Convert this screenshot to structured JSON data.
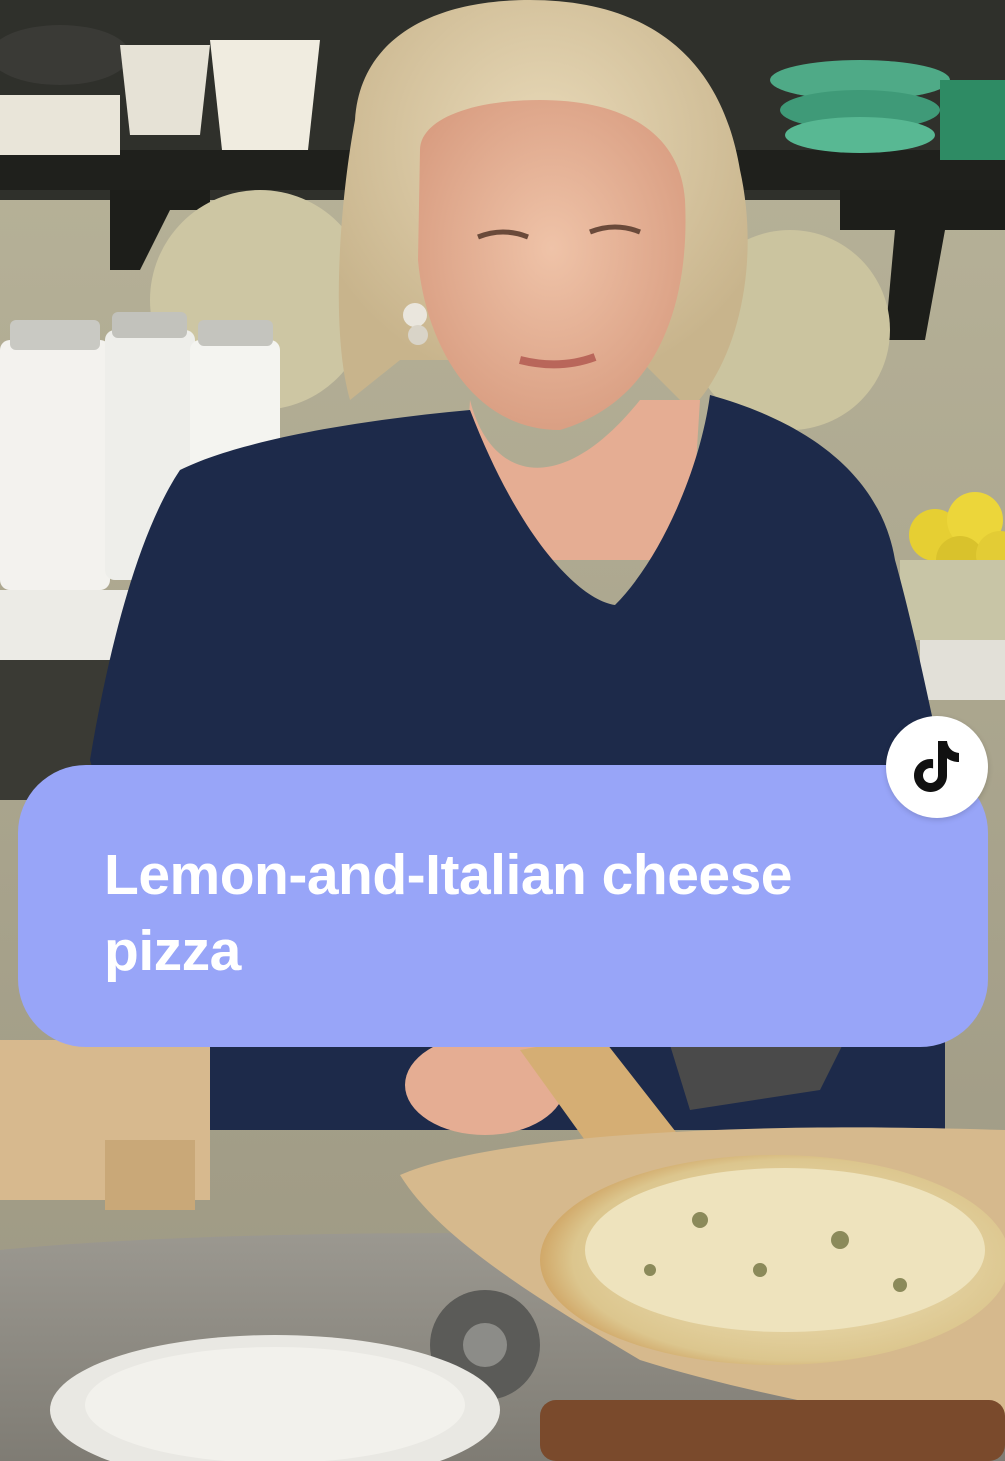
{
  "caption": {
    "text": "Lemon-and-Italian cheese pizza",
    "background_color": "#98a5f8",
    "text_color": "#ffffff"
  },
  "badge": {
    "icon": "tiktok-logo-icon",
    "background_color": "#ffffff",
    "icon_color": "#111111"
  }
}
